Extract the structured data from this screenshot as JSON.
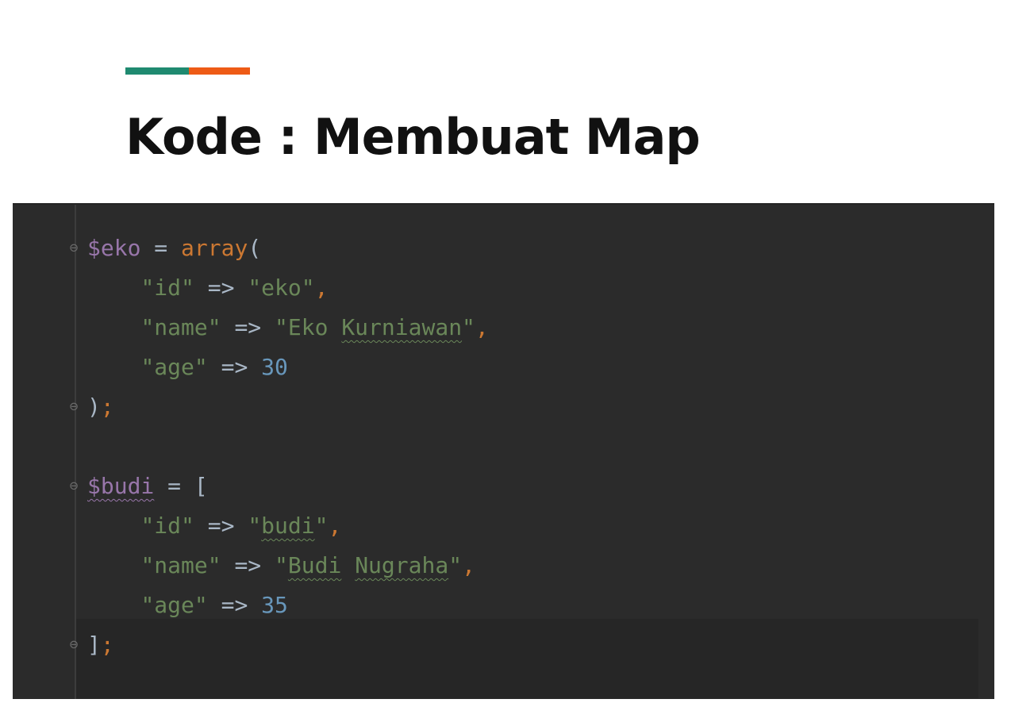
{
  "slide": {
    "title": "Kode : Membuat Map",
    "accent_colors": [
      "#1f8a70",
      "#ee5b16"
    ]
  },
  "code": {
    "lines": [
      {
        "tokens": [
          "$eko",
          " = ",
          "array",
          "("
        ]
      },
      {
        "tokens": [
          "    ",
          "\"id\"",
          " => ",
          "\"eko\"",
          ","
        ]
      },
      {
        "tokens": [
          "    ",
          "\"name\"",
          " => ",
          "\"Eko ",
          "Kurniawan",
          "\"",
          ","
        ]
      },
      {
        "tokens": [
          "    ",
          "\"age\"",
          " => ",
          "30"
        ]
      },
      {
        "tokens": [
          ")",
          ";"
        ]
      },
      {
        "tokens": [
          ""
        ]
      },
      {
        "tokens": [
          "$budi",
          " = ",
          "["
        ]
      },
      {
        "tokens": [
          "    ",
          "\"id\"",
          " => ",
          "\"",
          "budi",
          "\"",
          ","
        ]
      },
      {
        "tokens": [
          "    ",
          "\"name\"",
          " => ",
          "\"",
          "Budi",
          " ",
          "Nugraha",
          "\"",
          ","
        ]
      },
      {
        "tokens": [
          "    ",
          "\"age\"",
          " => ",
          "35"
        ]
      },
      {
        "tokens": [
          "]",
          ";"
        ]
      }
    ],
    "fold_icon": "fold-marker-icon"
  }
}
